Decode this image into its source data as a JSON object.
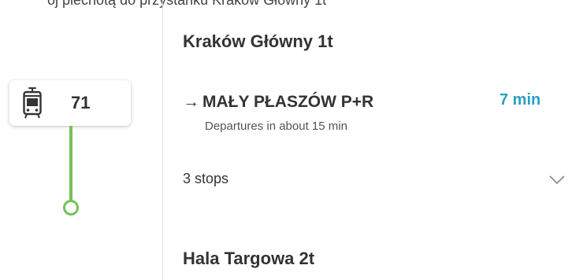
{
  "header": {
    "clipped_text": "oj piechotą do przystanku Kraków Główny 1t"
  },
  "line": {
    "number": "71",
    "icon": "tram-icon",
    "route_color": "#76c159"
  },
  "segment": {
    "from_stop": "Kraków Główny 1t",
    "direction_arrow": "→",
    "direction": "MAŁY PŁASZÓW P+R",
    "departure_text": "Departures in about 15 min",
    "duration": "7 min",
    "duration_color": "#2a9fc1",
    "stops_count": "3 stops",
    "expand_icon": "chevron-down-icon",
    "to_stop": "Hala Targowa 2t"
  }
}
